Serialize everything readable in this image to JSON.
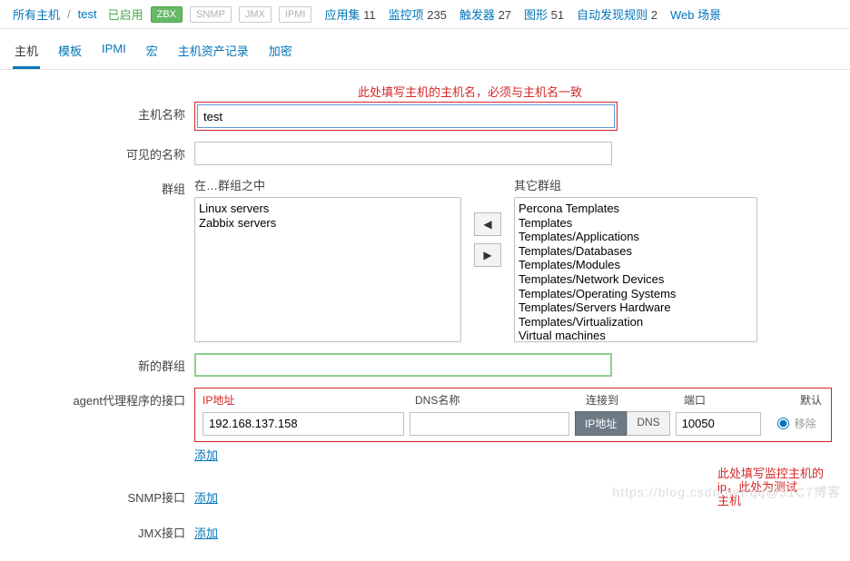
{
  "topbar": {
    "all_hosts": "所有主机",
    "crumb_sep": "/",
    "hostname": "test",
    "enabled": "已启用",
    "badges": {
      "zbx": "ZBX",
      "snmp": "SNMP",
      "jmx": "JMX",
      "ipmi": "IPMI"
    },
    "stats": {
      "applications_label": "应用集",
      "applications_count": "11",
      "items_label": "监控项",
      "items_count": "235",
      "triggers_label": "触发器",
      "triggers_count": "27",
      "graphs_label": "图形",
      "graphs_count": "51",
      "discovery_label": "自动发现规则",
      "discovery_count": "2",
      "web_label": "Web 场景"
    }
  },
  "tabs": {
    "host": "主机",
    "template": "模板",
    "ipmi": "IPMI",
    "macros": "宏",
    "inventory": "主机资产记录",
    "encryption": "加密"
  },
  "annotations": {
    "hostname_tip": "此处填写主机的主机名，必须与主机名一致",
    "ip_tip_line1": "此处填写监控主机的ip，此处为测试",
    "ip_tip_line2": "主机"
  },
  "labels": {
    "hostname": "主机名称",
    "visible_name": "可见的名称",
    "groups": "群组",
    "in_groups": "在…群组之中",
    "other_groups": "其它群组",
    "new_group": "新的群组",
    "agent_iface": "agent代理程序的接口",
    "snmp_iface": "SNMP接口",
    "jmx_iface": "JMX接口",
    "add": "添加",
    "remove": "移除"
  },
  "form": {
    "hostname_value": "test",
    "visible_name_value": "",
    "new_group_value": "",
    "in_groups_options": [
      "Linux servers",
      "Zabbix servers"
    ],
    "other_groups_options": [
      "Percona Templates",
      "Templates",
      "Templates/Applications",
      "Templates/Databases",
      "Templates/Modules",
      "Templates/Network Devices",
      "Templates/Operating Systems",
      "Templates/Servers Hardware",
      "Templates/Virtualization",
      "Virtual machines"
    ]
  },
  "iface": {
    "headers": {
      "ip": "IP地址",
      "dns": "DNS名称",
      "connect_to": "连接到",
      "port": "端口",
      "default": "默认"
    },
    "ip_value": "192.168.137.158",
    "dns_value": "",
    "port_value": "10050",
    "btn_ip": "IP地址",
    "btn_dns": "DNS"
  },
  "arrows": {
    "left": "◀",
    "right": "▶"
  },
  "watermark": "https://blog.csdn.net/qq@51C7博客"
}
